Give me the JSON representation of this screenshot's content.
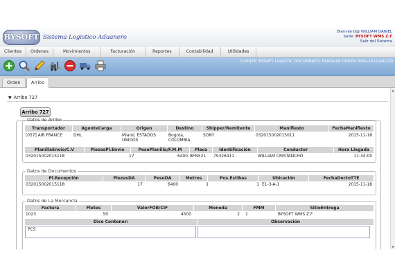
{
  "header": {
    "logo": "BYSOFT",
    "app_title": "Sistema Logistico Aduanero",
    "welcome": "Bienvenid@ WILLIAM DANIEL",
    "sede_label": "Sede:",
    "sede_value": "BYSOFT WMS Z.F",
    "logout": "Salir del Sistema"
  },
  "menu": [
    "Clientes",
    "Ordenes",
    "Movimientos",
    "Facturación",
    "Reportes",
    "Contabilidad",
    "Utilidades"
  ],
  "toolbar": {
    "icons": [
      "add-icon",
      "search-icon",
      "edit-icon",
      "forklift-icon",
      "delete-icon",
      "truck-icon",
      "print-icon"
    ],
    "info": "CLIENTE: BYSOFT LOGISTIC DOCUMENTO: BLNOV18 ORDEN: BOG-1511100120"
  },
  "tabs": [
    "Orden",
    "Arribo"
  ],
  "section_title": "Arribo 727",
  "panel_title": "Arribo 727",
  "datos_arribo": {
    "legend": "Datos de Arribo",
    "headers1": [
      "Transportador",
      "AgenteCarga",
      "Origen",
      "Destino",
      "Shipper/Remitente",
      "Manifiesto",
      "FechaManifiesto"
    ],
    "row1": [
      "[057] AIR FRANCE",
      "DHL",
      "Miami, ESTADOS UNIDOS",
      "Bogota, COLOMBIA",
      "SONY",
      "032015002015011",
      "2015-11-18"
    ],
    "headers2": [
      "PlanillaEnvio/C.V",
      "PiezasPl.Envio",
      "PesoPlanilla/F.M.M",
      "Placa",
      "Identificación",
      "Conductor",
      "Hora Llegada"
    ],
    "row2": [
      "032015002015118",
      "17",
      "6400",
      "BFN521",
      "79326411",
      "WILLIAM CRISTANCHO",
      "11:34:00"
    ]
  },
  "datos_documentos": {
    "legend": "Datos de Documentos",
    "headers": [
      "Pl.Recepción",
      "PiezasDA",
      "PesoDA",
      "Metros",
      "Pos.Estibas",
      "Ubicación",
      "FechaDoctoTTE"
    ],
    "row": [
      "032015002015118",
      "17",
      "6400",
      "1",
      "1",
      "E1-3-A-1",
      "2015-11-18"
    ]
  },
  "datos_mercancia": {
    "legend": "Datos de La Mercancía",
    "headers": [
      "Factura",
      "Fletes",
      "ValorFOB/CIF",
      "Moneda",
      "FMM",
      "SitioEntrega"
    ],
    "row": [
      "1023",
      "50",
      "4500",
      "2",
      "1",
      "BYSOFT WMS Z.F"
    ],
    "dice_contener_label": "Dice Contener:",
    "observacion_label": "Observación",
    "dice_contener_value": "PCS",
    "observacion_value": ""
  },
  "colors": {
    "toolbar": "#8fb5de",
    "header_text": "#1a3b8c",
    "highlight": "#c01010",
    "table_header": "#d4d4d4"
  }
}
